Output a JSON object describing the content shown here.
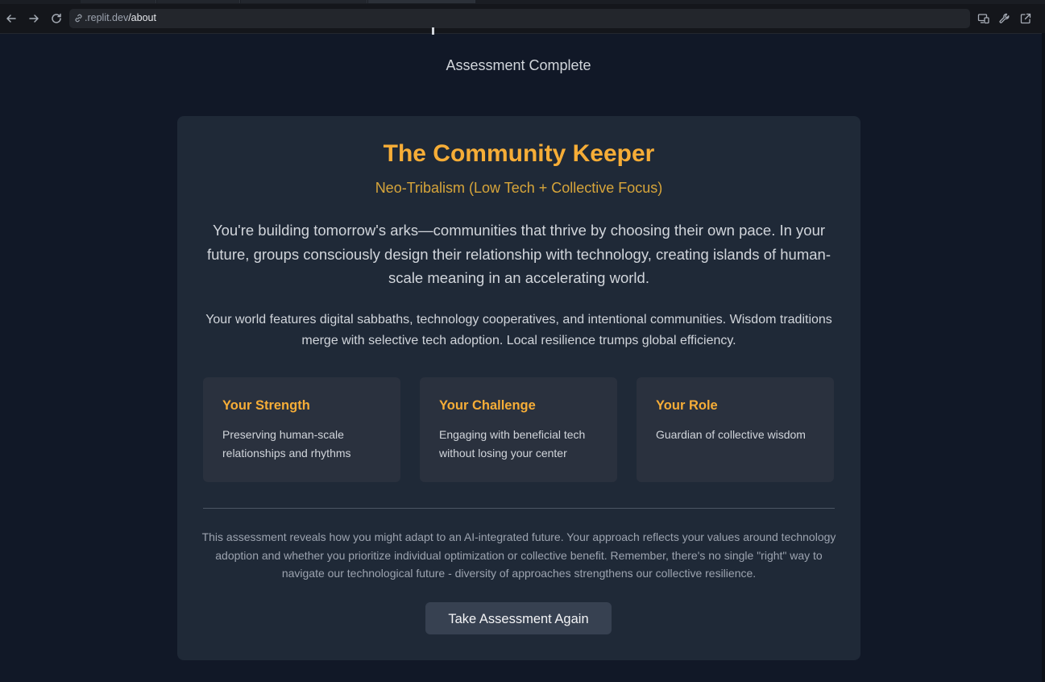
{
  "browser": {
    "url_host": ".replit.dev",
    "url_path": "/about",
    "icons": {
      "back": "arrow-left-icon",
      "forward": "arrow-right-icon",
      "reload": "reload-icon",
      "link": "link-icon",
      "devices": "devices-icon",
      "tools": "wrench-icon",
      "open": "external-link-icon"
    }
  },
  "page": {
    "subtitle": "Assessment Complete",
    "result": {
      "title": "The Community Keeper",
      "type": "Neo-Tribalism (Low Tech + Collective Focus)",
      "lead": "You're building tomorrow's arks—communities that thrive by choosing their own pace. In your future, groups consciously design their relationship with technology, creating islands of human-scale meaning in an accelerating world.",
      "description": "Your world features digital sabbaths, technology cooperatives, and intentional communities. Wisdom traditions merge with selective tech adoption. Local resilience trumps global efficiency.",
      "traits": [
        {
          "heading": "Your Strength",
          "text": "Preserving human-scale relationships and rhythms"
        },
        {
          "heading": "Your Challenge",
          "text": "Engaging with beneficial tech without losing your center"
        },
        {
          "heading": "Your Role",
          "text": "Guardian of collective wisdom"
        }
      ],
      "footnote": "This assessment reveals how you might adapt to an AI-integrated future. Your approach reflects your values around technology adoption and whether you prioritize individual optimization or collective benefit. Remember, there's no single \"right\" way to navigate our technological future - diversity of approaches strengthens our collective resilience.",
      "retake_label": "Take Assessment Again"
    }
  },
  "colors": {
    "background": "#111827",
    "card": "#1f2937",
    "accent": "#f6ad37",
    "button": "#374151"
  }
}
